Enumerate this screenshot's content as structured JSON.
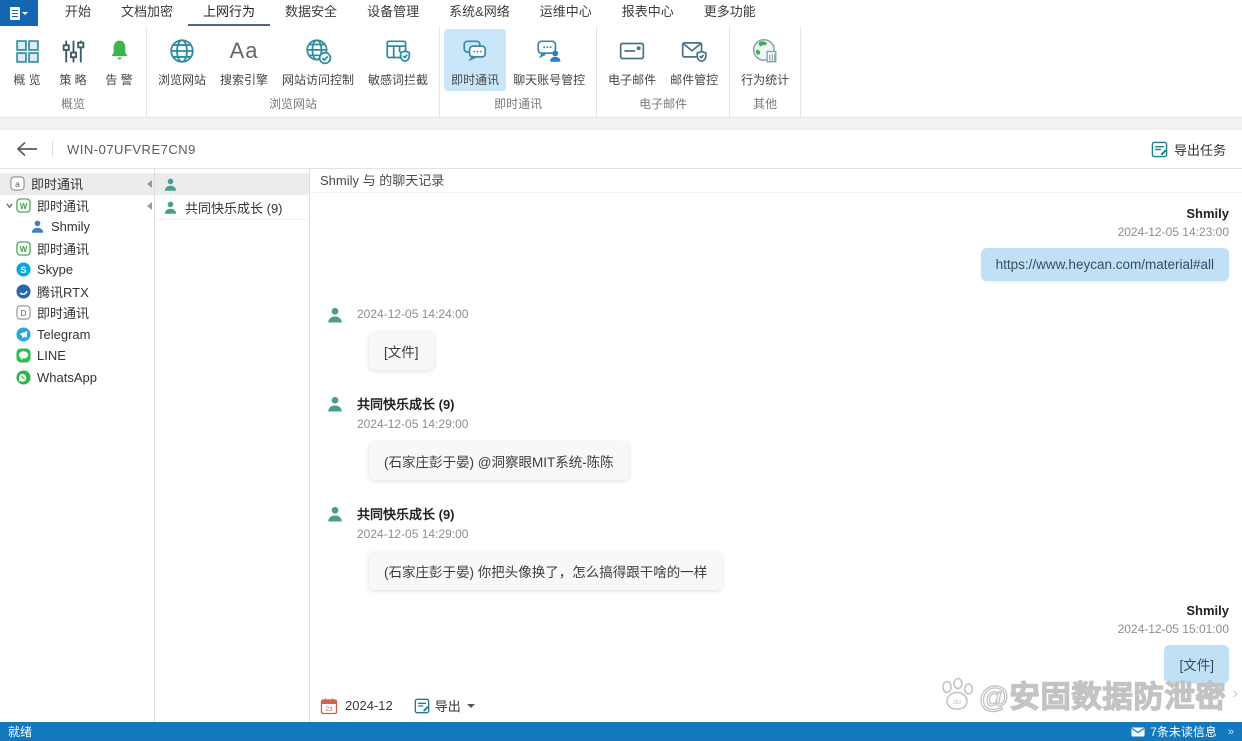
{
  "menu": {
    "tabs": [
      "开始",
      "文档加密",
      "上网行为",
      "数据安全",
      "设备管理",
      "系统&网络",
      "运维中心",
      "报表中心",
      "更多功能"
    ],
    "active_tab": "上网行为"
  },
  "ribbon": {
    "groups": [
      {
        "label": "概览",
        "buttons": [
          {
            "label": "概 览"
          },
          {
            "label": "策 略"
          },
          {
            "label": "告 警"
          }
        ]
      },
      {
        "label": "浏览网站",
        "buttons": [
          {
            "label": "浏览网站"
          },
          {
            "label": "搜索引擎"
          },
          {
            "label": "网站访问控制"
          },
          {
            "label": "敏感词拦截"
          }
        ]
      },
      {
        "label": "即时通讯",
        "buttons": [
          {
            "label": "即时通讯",
            "selected": true
          },
          {
            "label": "聊天账号管控"
          }
        ]
      },
      {
        "label": "电子邮件",
        "buttons": [
          {
            "label": "电子邮件"
          },
          {
            "label": "邮件管控"
          }
        ]
      },
      {
        "label": "其他",
        "buttons": [
          {
            "label": "行为统计"
          }
        ]
      }
    ]
  },
  "toolbar": {
    "computer_name": "WIN-07UFVRE7CN9",
    "export_task_label": "导出任务"
  },
  "sidebar": {
    "items": [
      {
        "label": "即时通讯"
      },
      {
        "label": "即时通讯"
      },
      {
        "label": "Shmily"
      },
      {
        "label": "即时通讯"
      },
      {
        "label": "Skype"
      },
      {
        "label": "腾讯RTX"
      },
      {
        "label": "即时通讯"
      },
      {
        "label": "Telegram"
      },
      {
        "label": "LINE"
      },
      {
        "label": "WhatsApp"
      }
    ]
  },
  "contacts": {
    "items": [
      {
        "label": "共同快乐成长 (9)"
      }
    ]
  },
  "chat": {
    "title": "Shmily 与  的聊天记录",
    "messages": [
      {
        "side": "right",
        "sender": "Shmily",
        "time": "2024-12-05 14:23:00",
        "text": "https://www.heycan.com/material#all"
      },
      {
        "side": "left",
        "sender": "",
        "time": "2024-12-05 14:24:00",
        "text": "[文件]"
      },
      {
        "side": "left",
        "sender": "共同快乐成长 (9)",
        "time": "2024-12-05 14:29:00",
        "text": "(石家庄彭于晏) @洞察眼MIT系统-陈陈"
      },
      {
        "side": "left",
        "sender": "共同快乐成长 (9)",
        "time": "2024-12-05 14:29:00",
        "text": "(石家庄彭于晏) 你把头像换了，怎么搞得跟干啥的一样"
      },
      {
        "side": "right",
        "sender": "Shmily",
        "time": "2024-12-05 15:01:00",
        "text": "[文件]"
      }
    ],
    "footer": {
      "date": "2024-12",
      "export_label": "导出"
    }
  },
  "watermark": {
    "text": "@安固数据防泄密"
  },
  "statusbar": {
    "status": "就绪",
    "unread": "7条未读信息"
  }
}
